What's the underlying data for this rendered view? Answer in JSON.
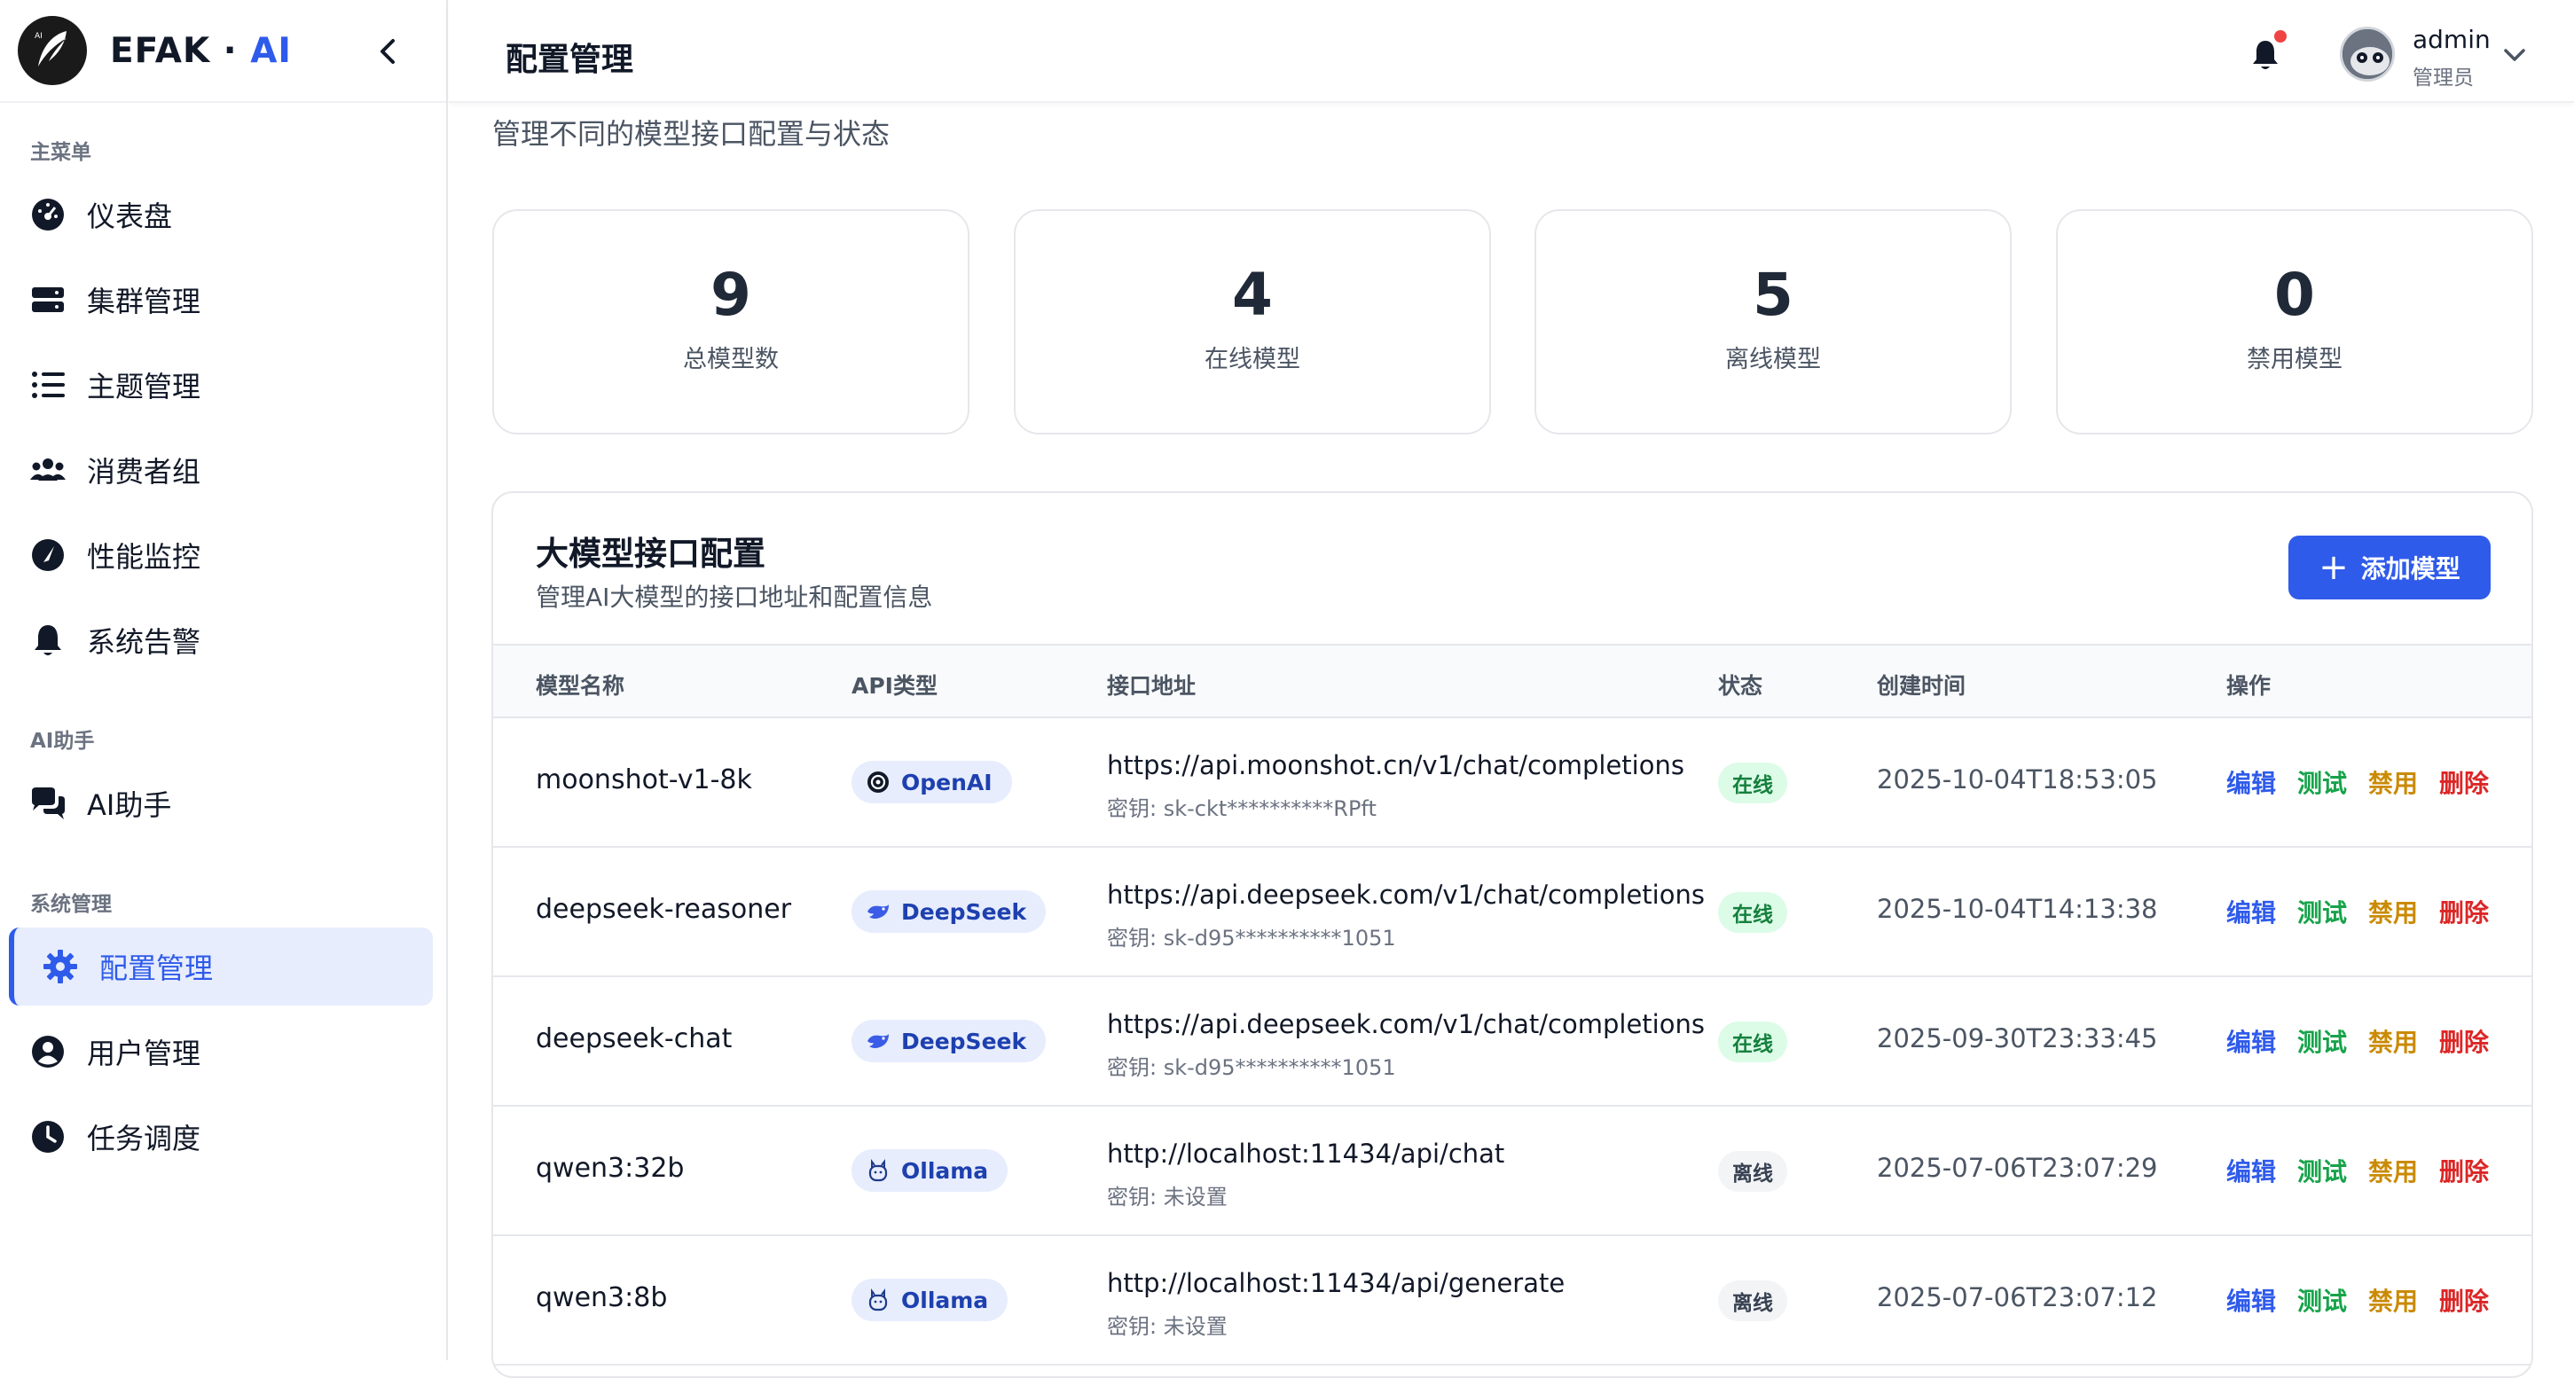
{
  "brand": {
    "name": "EFAK",
    "dot": "·",
    "ai": "AI",
    "logo_text": "AI"
  },
  "sidebar": {
    "section_main": "主菜单",
    "section_ai": "AI助手",
    "section_system": "系统管理",
    "items": [
      {
        "label": "仪表盘",
        "icon": "dashboard-icon"
      },
      {
        "label": "集群管理",
        "icon": "server-icon"
      },
      {
        "label": "主题管理",
        "icon": "list-icon"
      },
      {
        "label": "消费者组",
        "icon": "users-icon"
      },
      {
        "label": "性能监控",
        "icon": "gauge-icon"
      },
      {
        "label": "系统告警",
        "icon": "bell-icon"
      },
      {
        "label": "AI助手",
        "icon": "chat-icon"
      },
      {
        "label": "配置管理",
        "icon": "gear-icon",
        "active": true
      },
      {
        "label": "用户管理",
        "icon": "user-icon"
      },
      {
        "label": "任务调度",
        "icon": "clock-icon"
      }
    ]
  },
  "header": {
    "title": "配置管理",
    "user": {
      "name": "admin",
      "role": "管理员"
    }
  },
  "main": {
    "subtitle": "管理不同的模型接口配置与状态",
    "stats": [
      {
        "value": "9",
        "label": "总模型数"
      },
      {
        "value": "4",
        "label": "在线模型"
      },
      {
        "value": "5",
        "label": "离线模型"
      },
      {
        "value": "0",
        "label": "禁用模型"
      }
    ],
    "panel": {
      "title": "大模型接口配置",
      "desc": "管理AI大模型的接口地址和配置信息",
      "add_button": "添加模型",
      "columns": [
        "模型名称",
        "API类型",
        "接口地址",
        "状态",
        "创建时间",
        "操作"
      ],
      "actions": {
        "edit": "编辑",
        "test": "测试",
        "disable": "禁用",
        "delete": "删除"
      },
      "rows": [
        {
          "name": "moonshot-v1-8k",
          "api": "OpenAI",
          "url": "https://api.moonshot.cn/v1/chat/completions",
          "key": "密钥: sk-ckt**********RPft",
          "status": "在线",
          "created": "2025-10-04T18:53:05"
        },
        {
          "name": "deepseek-reasoner",
          "api": "DeepSeek",
          "url": "https://api.deepseek.com/v1/chat/completions",
          "key": "密钥: sk-d95**********1051",
          "status": "在线",
          "created": "2025-10-04T14:13:38"
        },
        {
          "name": "deepseek-chat",
          "api": "DeepSeek",
          "url": "https://api.deepseek.com/v1/chat/completions",
          "key": "密钥: sk-d95**********1051",
          "status": "在线",
          "created": "2025-09-30T23:33:45"
        },
        {
          "name": "qwen3:32b",
          "api": "Ollama",
          "url": "http://localhost:11434/api/chat",
          "key": "密钥: 未设置",
          "status": "离线",
          "created": "2025-07-06T23:07:29"
        },
        {
          "name": "qwen3:8b",
          "api": "Ollama",
          "url": "http://localhost:11434/api/generate",
          "key": "密钥: 未设置",
          "status": "离线",
          "created": "2025-07-06T23:07:12"
        }
      ]
    }
  },
  "colors": {
    "accent": "#2f5bea",
    "online": "#15803d",
    "test": "#16a34a",
    "disable": "#ca8a04",
    "delete": "#dc2626"
  }
}
